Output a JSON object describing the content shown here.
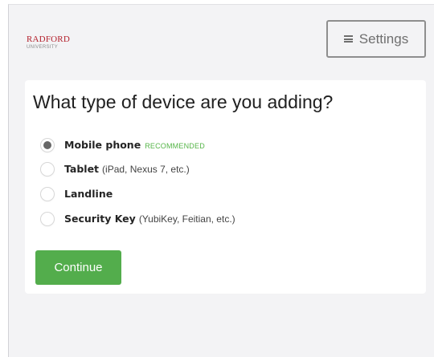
{
  "header": {
    "logo": {
      "name": "RADFORD",
      "subtitle": "UNIVERSITY",
      "brand_color": "#b3202c"
    },
    "settings": {
      "label": "Settings",
      "icon": "hamburger-menu-icon"
    }
  },
  "main": {
    "title": "What type of device are you adding?",
    "selected_option": "mobile-phone",
    "options": [
      {
        "id": "mobile-phone",
        "label": "Mobile phone",
        "description": "",
        "badge": "RECOMMENDED",
        "selected": true
      },
      {
        "id": "tablet",
        "label": "Tablet",
        "description": "(iPad, Nexus 7, etc.)",
        "badge": "",
        "selected": false
      },
      {
        "id": "landline",
        "label": "Landline",
        "description": "",
        "badge": "",
        "selected": false
      },
      {
        "id": "security-key",
        "label": "Security Key",
        "description": "(YubiKey, Feitian, etc.)",
        "badge": "",
        "selected": false
      }
    ],
    "continue_button": {
      "label": "Continue",
      "color": "#53ad4c"
    }
  },
  "colors": {
    "background": "#f3f3f5",
    "card": "#ffffff",
    "accent_green": "#55b548"
  }
}
